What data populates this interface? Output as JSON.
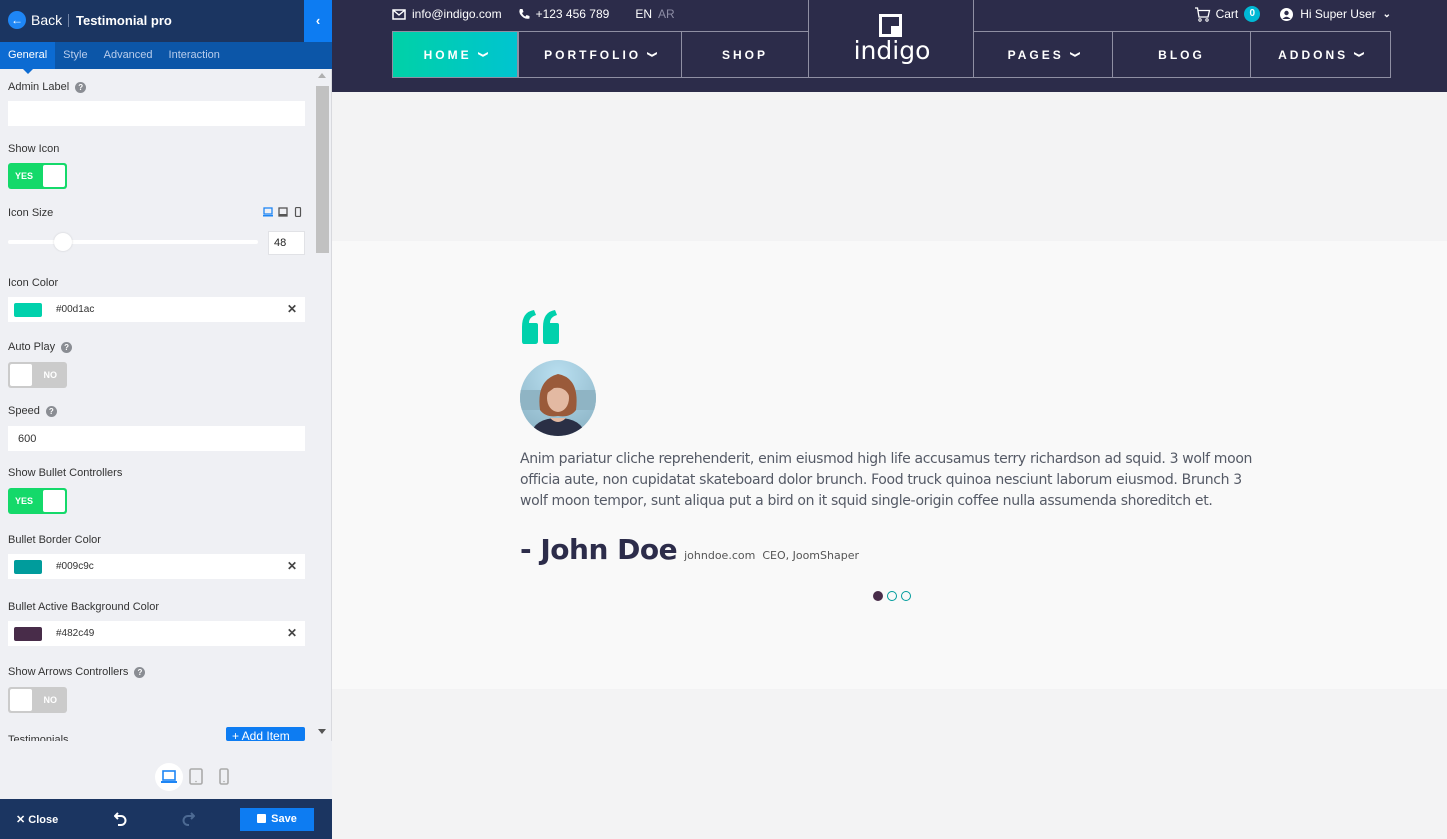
{
  "panel": {
    "back_label": "Back",
    "title": "Testimonial pro",
    "collapse_icon": "chevron-left-icon",
    "tabs": [
      {
        "label": "General",
        "active": true
      },
      {
        "label": "Style",
        "active": false
      },
      {
        "label": "Advanced",
        "active": false
      },
      {
        "label": "Interaction",
        "active": false
      }
    ],
    "fields": {
      "admin_label": {
        "label": "Admin Label",
        "value": "",
        "help": "?"
      },
      "show_icon": {
        "label": "Show Icon",
        "state": "YES"
      },
      "icon_size": {
        "label": "Icon Size",
        "value": "48",
        "slider_fraction": 0.22
      },
      "icon_color": {
        "label": "Icon Color",
        "value": "#00d1ac",
        "clear": "✕"
      },
      "auto_play": {
        "label": "Auto Play",
        "state": "NO",
        "help": "?"
      },
      "speed": {
        "label": "Speed",
        "value": "600",
        "help": "?"
      },
      "show_bullets": {
        "label": "Show Bullet Controllers",
        "state": "YES"
      },
      "bullet_border_color": {
        "label": "Bullet Border Color",
        "value": "#009c9c",
        "clear": "✕"
      },
      "bullet_active_bg": {
        "label": "Bullet Active Background Color",
        "value": "#482c49",
        "clear": "✕"
      },
      "show_arrows": {
        "label": "Show Arrows Controllers",
        "state": "NO",
        "help": "?"
      },
      "testimonials": {
        "label": "Testimonials"
      }
    },
    "add_item_label": "+ Add Item",
    "footer": {
      "close_label": "✕ Close",
      "save_label": "Save"
    }
  },
  "site": {
    "topbar": {
      "email": "info@indigo.com",
      "phone": "+123 456 789",
      "lang_en": "EN",
      "lang_ar": "AR",
      "cart_label": "Cart",
      "cart_count": "0",
      "user_label": "Hi Super User"
    },
    "logo_text": "indigo",
    "nav": [
      {
        "label": "HOME",
        "dropdown": true,
        "active": true
      },
      {
        "label": "PORTFOLIO",
        "dropdown": true
      },
      {
        "label": "SHOP",
        "dropdown": false
      },
      {
        "label": "PAGES",
        "dropdown": true
      },
      {
        "label": "BLOG",
        "dropdown": false
      },
      {
        "label": "ADDONS",
        "dropdown": true
      }
    ],
    "testimonial": {
      "text": "Anim pariatur cliche reprehenderit, enim eiusmod high life accusamus terry richardson ad squid. 3 wolf moon officia aute, non cupidatat skateboard dolor brunch. Food truck quinoa nesciunt laborum eiusmod. Brunch 3 wolf moon tempor, sunt aliqua put a bird on it squid single-origin coffee nulla assumenda shoreditch et.",
      "author": "- John Doe",
      "url": "johndoe.com",
      "role": "CEO, JoomShaper",
      "bullets": 3,
      "active_bullet": 0,
      "icon_color": "#00d1ac"
    }
  }
}
